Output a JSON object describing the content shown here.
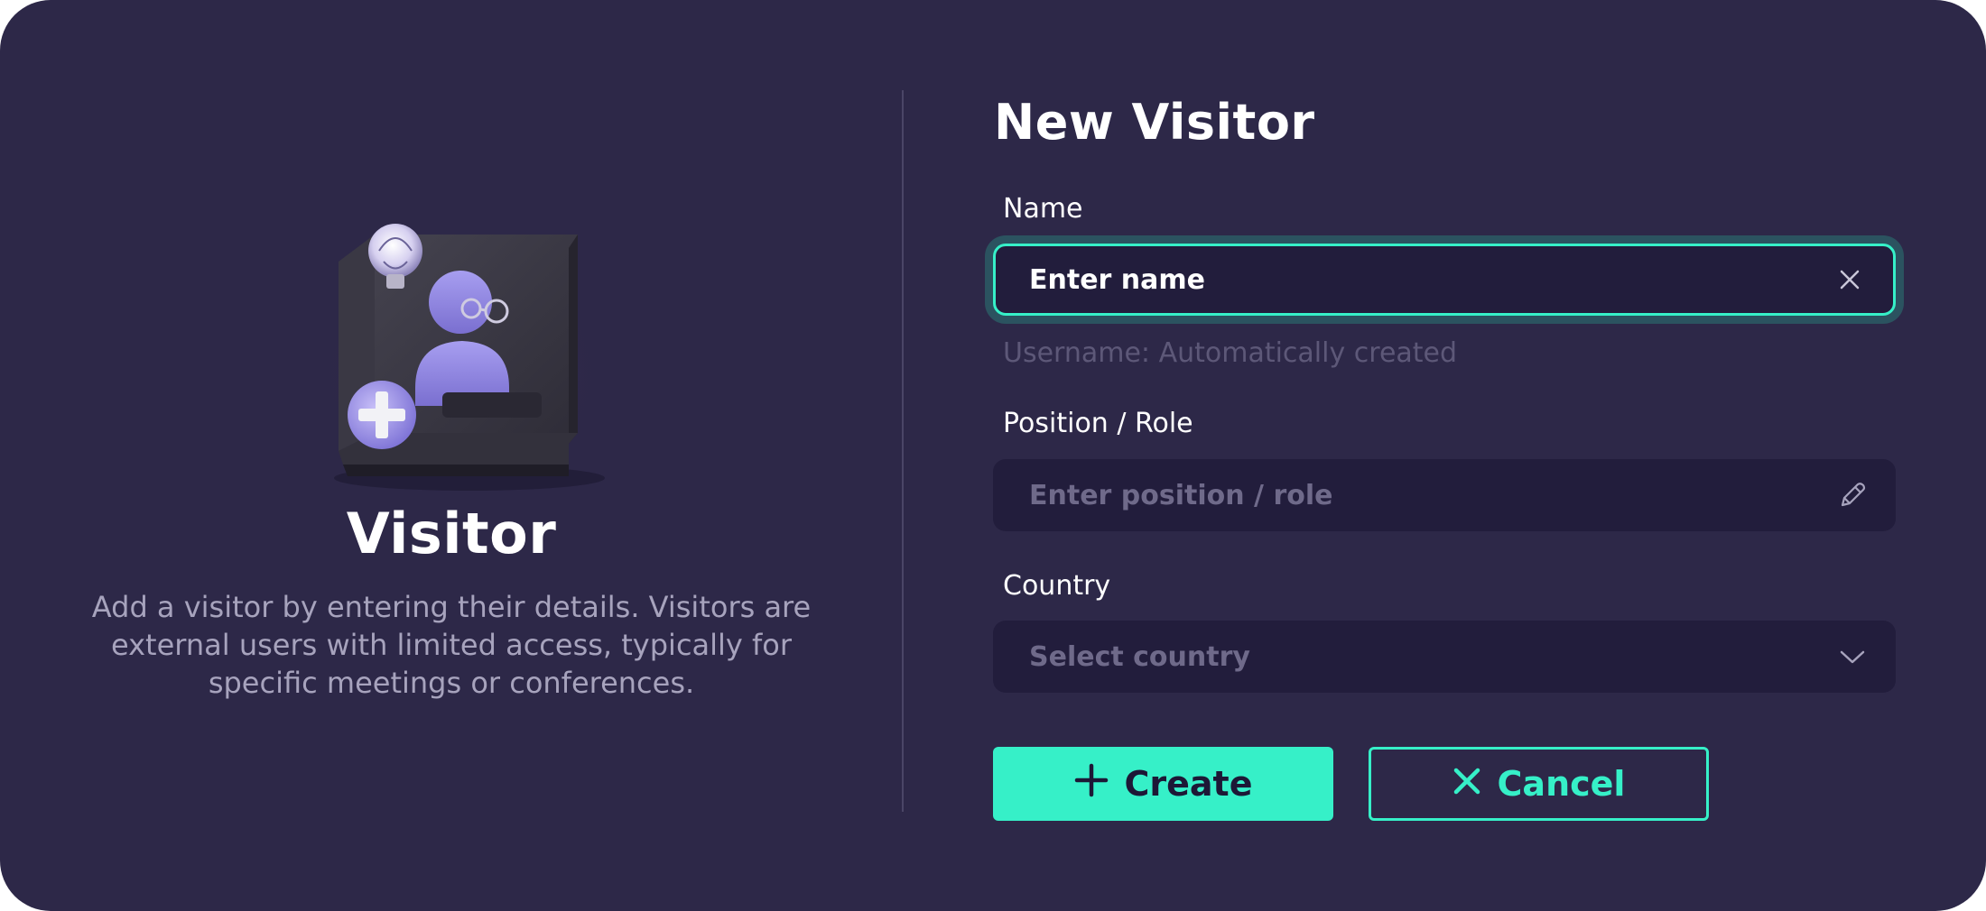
{
  "left": {
    "title": "Visitor",
    "description": "Add a visitor by entering their details. Visitors are external users with limited access, typically for specific meetings or conferences.",
    "illustration": "visitor-3d-illustration"
  },
  "form": {
    "title": "New Visitor",
    "name": {
      "label": "Name",
      "value": "Enter name",
      "icon": "clear-icon",
      "helper": "Username: Automatically created"
    },
    "position": {
      "label": "Position / Role",
      "placeholder": "Enter position / role",
      "icon": "pencil-icon"
    },
    "country": {
      "label": "Country",
      "placeholder": "Select country",
      "icon": "chevron-down-icon"
    },
    "buttons": {
      "create": "Create",
      "cancel": "Cancel"
    }
  },
  "colors": {
    "background": "#2d2848",
    "input_bg": "#221d3c",
    "accent": "#36f0c8",
    "muted_text": "#a7a3bd"
  }
}
